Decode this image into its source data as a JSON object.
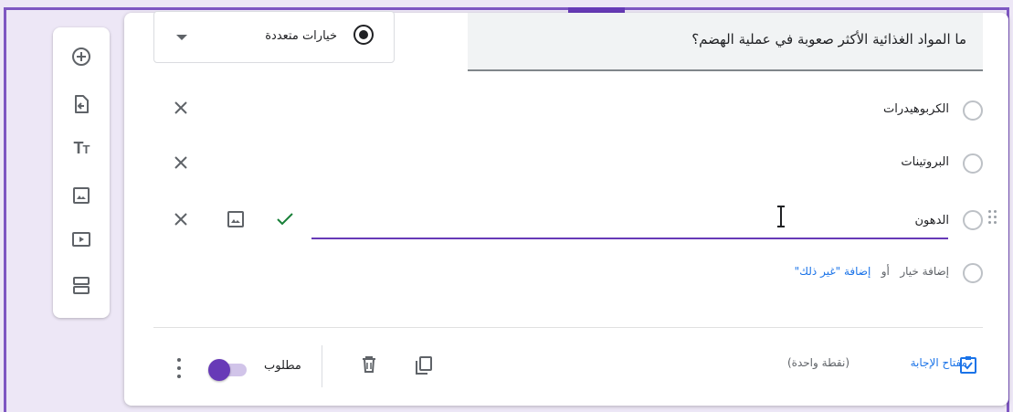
{
  "question": {
    "text": "ما المواد الغذائية الأكثر صعوبة في عملية الهضم؟",
    "type_label": "خيارات متعددة"
  },
  "options": [
    {
      "label": "الكربوهيدرات"
    },
    {
      "label": "البروتينات"
    },
    {
      "label": "الدهون"
    }
  ],
  "add_option": {
    "add_label": "إضافة خيار",
    "or_label": "أو",
    "add_other_label": "إضافة \"غير ذلك\""
  },
  "footer": {
    "answer_key_label": "مفتاح الإجابة",
    "points_label": "(نقطة واحدة)",
    "required_label": "مطلوب",
    "required_on": true
  },
  "colors": {
    "accent": "#673ab7",
    "link": "#1a73e8",
    "check": "#188038",
    "background": "#ede7f6"
  },
  "icons": {
    "toolbar": [
      "add-question-icon",
      "import-questions-icon",
      "add-title-icon",
      "add-image-icon",
      "add-video-icon",
      "add-section-icon"
    ],
    "option_row": [
      "remove-option-icon",
      "add-image-icon",
      "check-icon",
      "drag-handle-icon"
    ],
    "footer": [
      "answer-key-icon",
      "duplicate-icon",
      "delete-icon",
      "more-options-icon"
    ]
  }
}
